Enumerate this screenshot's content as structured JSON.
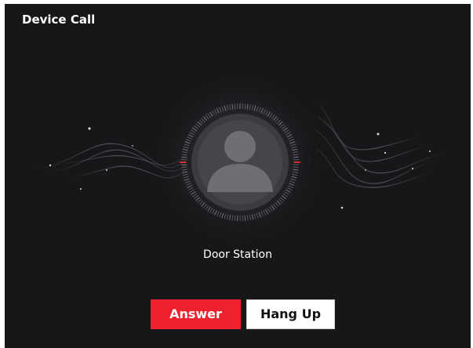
{
  "dialog": {
    "title": "Device Call",
    "caller_name": "Door Station",
    "caller_icon": "user-avatar-icon"
  },
  "actions": {
    "answer_label": "Answer",
    "hangup_label": "Hang Up"
  },
  "colors": {
    "background": "#171719",
    "answer": "#f0212e",
    "hangup": "#ffffff",
    "avatar": "#6d6e73"
  }
}
